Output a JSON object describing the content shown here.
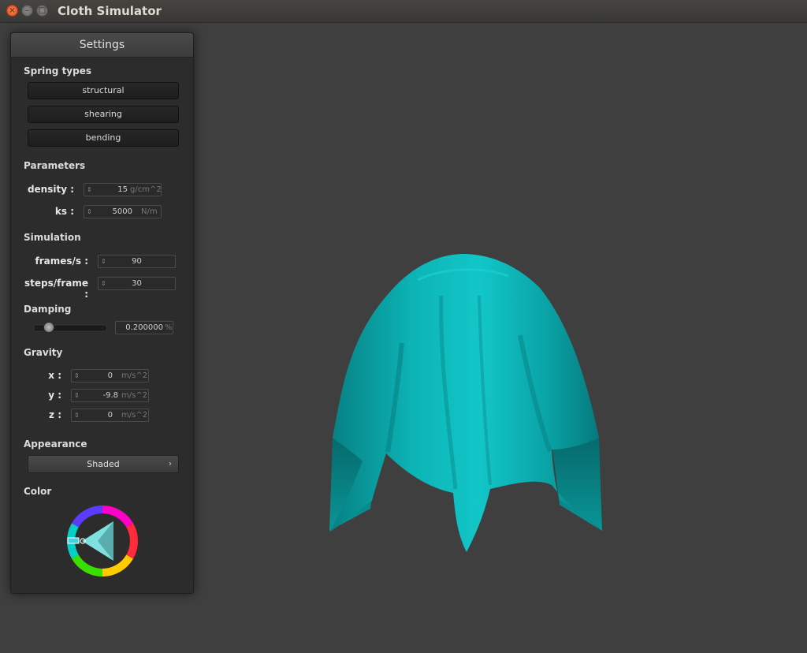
{
  "window": {
    "title": "Cloth Simulator"
  },
  "panel": {
    "title": "Settings",
    "spring_types": {
      "heading": "Spring types",
      "buttons": [
        "structural",
        "shearing",
        "bending"
      ]
    },
    "parameters": {
      "heading": "Parameters",
      "density": {
        "label": "density :",
        "value": "15",
        "unit": "g/cm^2"
      },
      "ks": {
        "label": "ks :",
        "value": "5000",
        "unit": "N/m"
      }
    },
    "simulation": {
      "heading": "Simulation",
      "fps": {
        "label": "frames/s :",
        "value": "90"
      },
      "steps": {
        "label": "steps/frame :",
        "value": "30"
      }
    },
    "damping": {
      "heading": "Damping",
      "slider_fraction": 0.2,
      "value": "0.200000",
      "unit": "%"
    },
    "gravity": {
      "heading": "Gravity",
      "x": {
        "label": "x :",
        "value": "0",
        "unit": "m/s^2"
      },
      "y": {
        "label": "y :",
        "value": "-9.8",
        "unit": "m/s^2"
      },
      "z": {
        "label": "z :",
        "value": "0",
        "unit": "m/s^2"
      }
    },
    "appearance": {
      "heading": "Appearance",
      "selected": "Shaded"
    },
    "color": {
      "heading": "Color",
      "selected_hex": "#00c8c8"
    }
  },
  "viewport": {
    "cloth_color": "#0aa9ab",
    "background": "#3f3f3f"
  }
}
